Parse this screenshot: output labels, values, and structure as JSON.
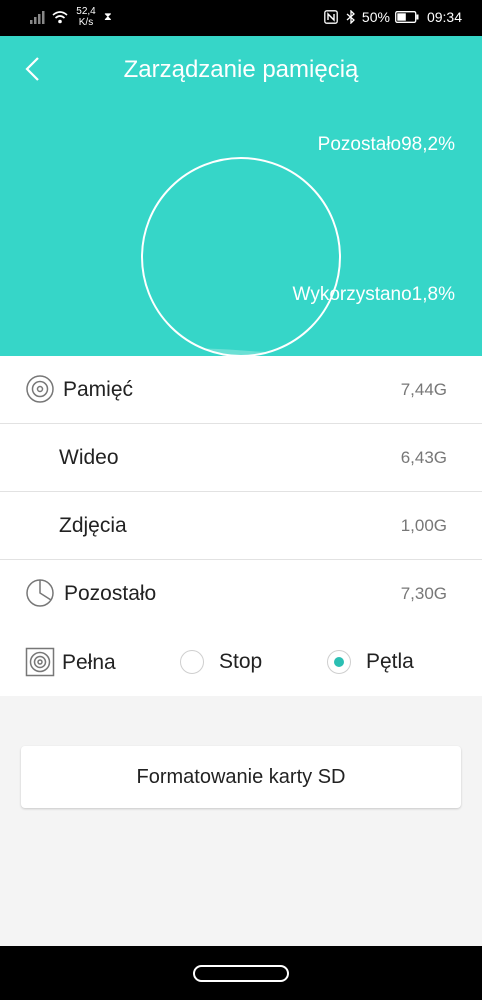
{
  "status_bar": {
    "net_speed_value": "52,4",
    "net_speed_unit": "K/s",
    "hourglass_glyph": "⧗",
    "battery": "50%",
    "time": "09:34",
    "icons": [
      "signal-icon",
      "wifi-icon",
      "hourglass-icon",
      "nfc-icon",
      "bluetooth-icon",
      "battery-icon"
    ]
  },
  "header": {
    "title": "Zarządzanie pamięcią",
    "remaining_label": "Pozostało98,2%",
    "used_label": "Wykorzystano1,8%",
    "accent_color": "#36d6c8",
    "used_fraction": 0.018,
    "remaining_fraction": 0.982
  },
  "storage": {
    "rows": [
      {
        "label": "Pamięć",
        "value": "7,44G",
        "icon": "storage-icon"
      },
      {
        "label": "Wideo",
        "value": "6,43G"
      },
      {
        "label": "Zdjęcia",
        "value": "1,00G"
      },
      {
        "label": "Pozostało",
        "value": "7,30G",
        "icon": "pie-chart-icon"
      }
    ]
  },
  "record_mode": {
    "label": "Pełna",
    "icon": "sd-card-icon",
    "options": [
      {
        "label": "Stop",
        "checked": false
      },
      {
        "label": "Pętla",
        "checked": true
      }
    ],
    "selected": "Pętla",
    "radio_color": "#2bbfb3"
  },
  "actions": {
    "format_label": "Formatowanie karty SD"
  }
}
